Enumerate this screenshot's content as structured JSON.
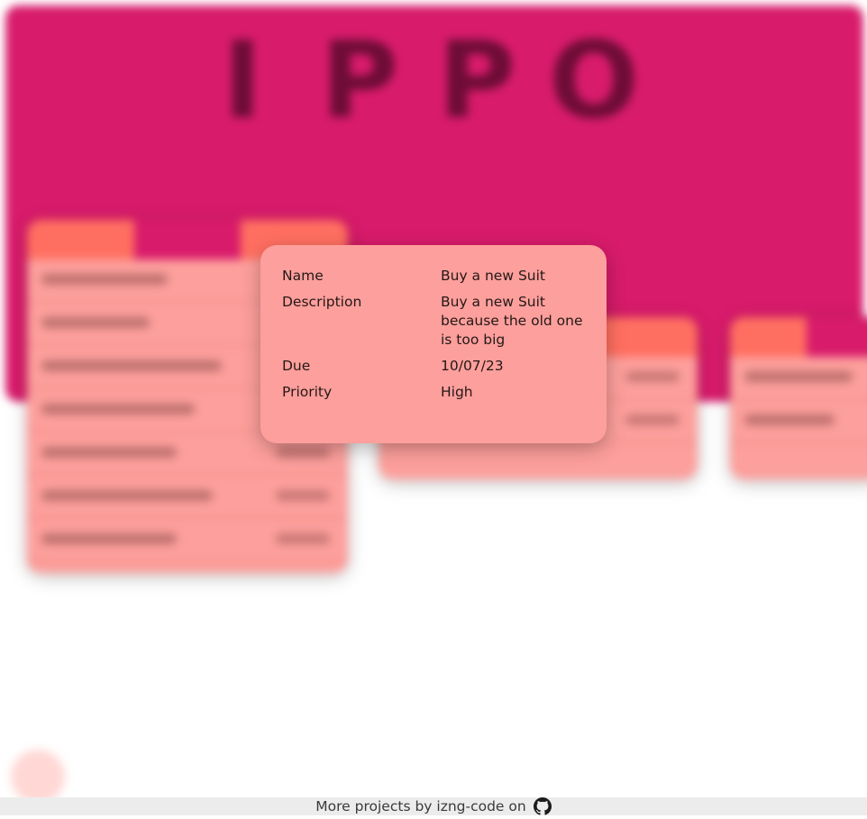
{
  "app": {
    "logo_letters": [
      "I",
      "P",
      "P",
      "O"
    ]
  },
  "task_details": {
    "name_label": "Name",
    "name_value": "Buy a new Suit",
    "description_label": "Description",
    "description_value": "Buy a new Suit because the old one is too big",
    "due_label": "Due",
    "due_value": "10/07/23",
    "priority_label": "Priority",
    "priority_value": "High"
  },
  "footer": {
    "text": "More projects by izng-code on",
    "icon": "github-icon"
  },
  "colors": {
    "hero": "#d81b6b",
    "panel": "#fd9f9c",
    "accent": "#ff6f61",
    "logo": "#6e0c37"
  }
}
